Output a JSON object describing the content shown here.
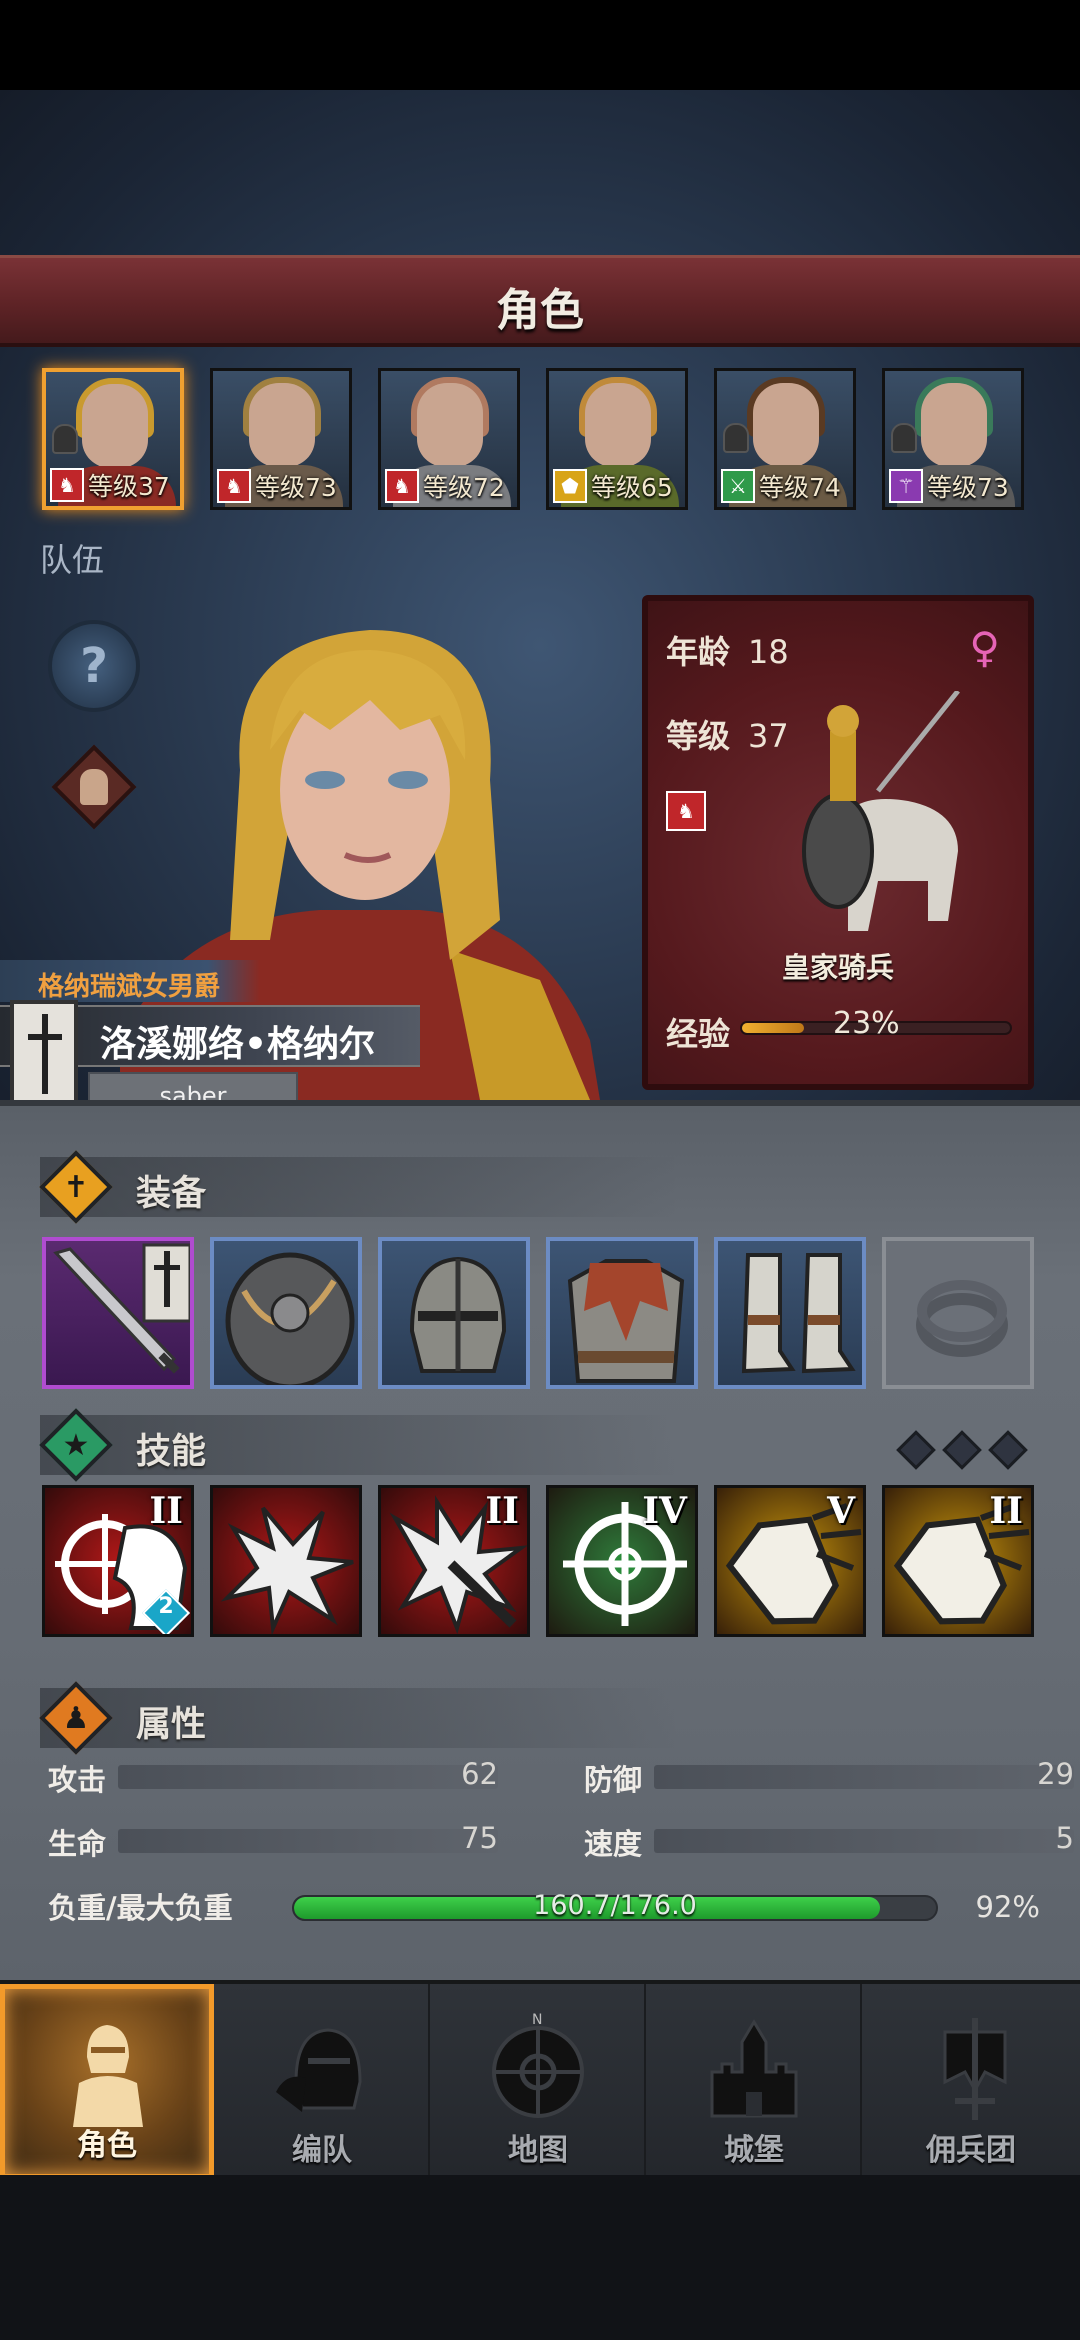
{
  "screen_title": "角色",
  "party": [
    {
      "level_text": "等级37",
      "class_color": "#c0262a",
      "class_icon": "horse-icon",
      "hair": "#c99a2e",
      "armor": "#8a2a24",
      "selected": true,
      "has_helm": true
    },
    {
      "level_text": "等级73",
      "class_color": "#c0262a",
      "class_icon": "horse-icon",
      "hair": "#a08040",
      "armor": "#6a5a4a",
      "selected": false,
      "has_helm": false
    },
    {
      "level_text": "等级72",
      "class_color": "#c0262a",
      "class_icon": "horse-icon",
      "hair": "#b07a60",
      "armor": "#7a7c80",
      "selected": false,
      "has_helm": false
    },
    {
      "level_text": "等级65",
      "class_color": "#d8a418",
      "class_icon": "shield-icon",
      "hair": "#c08a3a",
      "armor": "#5a6a2a",
      "selected": false,
      "has_helm": false
    },
    {
      "level_text": "等级74",
      "class_color": "#2f9a4a",
      "class_icon": "crossed-swords-icon",
      "hair": "#5a3a22",
      "armor": "#6a5a44",
      "selected": false,
      "has_helm": true
    },
    {
      "level_text": "等级73",
      "class_color": "#8a3ab0",
      "class_icon": "staff-icon",
      "hair": "#3a7a5a",
      "armor": "#5a5a5a",
      "selected": false,
      "has_helm": true
    }
  ],
  "team_label": "队伍",
  "help_icon": "?",
  "character": {
    "title": "格纳瑞斌女男爵",
    "name": "洛溪娜络•格纳尔",
    "nickname": "saber",
    "age_label": "年龄",
    "age": "18",
    "gender_icon": "♀",
    "level_label": "等级",
    "level": "37",
    "unit_name": "皇家骑兵",
    "exp_label": "经验",
    "exp_percent_text": "23%",
    "exp_fraction": 0.23
  },
  "equipment": {
    "label": "装备",
    "slots": [
      "sword-icon",
      "shield-icon",
      "helmet-icon",
      "chainmail-icon",
      "boots-icon",
      "ring-icon"
    ]
  },
  "skills": {
    "label": "技能",
    "items": [
      {
        "icon": "target-horse-icon",
        "rank": "II",
        "bg": "#b01818",
        "badge": "2"
      },
      {
        "icon": "charge-fist-icon",
        "rank": "",
        "bg": "#b01818",
        "badge": ""
      },
      {
        "icon": "impact-arrow-icon",
        "rank": "II",
        "bg": "#b01818",
        "badge": ""
      },
      {
        "icon": "crosshair-icon",
        "rank": "IV",
        "bg": "#2f7a3a",
        "badge": ""
      },
      {
        "icon": "shield-break-icon",
        "rank": "V",
        "bg": "#c9960c",
        "badge": ""
      },
      {
        "icon": "shield-break-icon",
        "rank": "II",
        "bg": "#c9960c",
        "badge": ""
      }
    ]
  },
  "attributes": {
    "label": "属性",
    "attack_label": "攻击",
    "attack": "62",
    "defense_label": "防御",
    "defense": "29",
    "hp_label": "生命",
    "hp": "75",
    "speed_label": "速度",
    "speed": "5",
    "load_label": "负重/最大负重",
    "load_text": "160.7/176.0",
    "load_percent": "92%",
    "load_fraction": 0.913
  },
  "nav": {
    "tabs": [
      {
        "label": "角色",
        "icon": "knight-icon",
        "active": true
      },
      {
        "label": "编队",
        "icon": "helmet-group-icon",
        "active": false
      },
      {
        "label": "地图",
        "icon": "compass-icon",
        "active": false
      },
      {
        "label": "城堡",
        "icon": "castle-icon",
        "active": false
      },
      {
        "label": "佣兵团",
        "icon": "banner-sword-icon",
        "active": false
      }
    ]
  },
  "colors": {
    "accent": "#f29a2a",
    "banner": "#6a2a2d"
  }
}
